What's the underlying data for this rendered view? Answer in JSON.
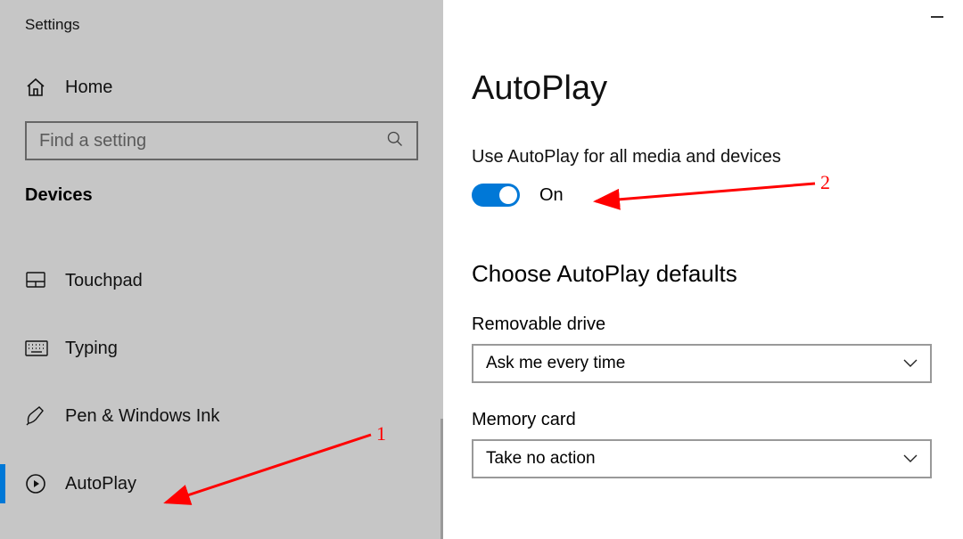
{
  "app_title": "Settings",
  "sidebar": {
    "home_label": "Home",
    "search_placeholder": "Find a setting",
    "section_label": "Devices",
    "items": [
      {
        "label": "Touchpad"
      },
      {
        "label": "Typing"
      },
      {
        "label": "Pen & Windows Ink"
      },
      {
        "label": "AutoPlay"
      }
    ]
  },
  "page": {
    "title": "AutoPlay",
    "toggle_desc": "Use AutoPlay for all media and devices",
    "toggle_state": "On",
    "sub_title": "Choose AutoPlay defaults",
    "removable_label": "Removable drive",
    "removable_value": "Ask me every time",
    "memory_label": "Memory card",
    "memory_value": "Take no action"
  },
  "annotations": {
    "n1": "1",
    "n2": "2"
  }
}
